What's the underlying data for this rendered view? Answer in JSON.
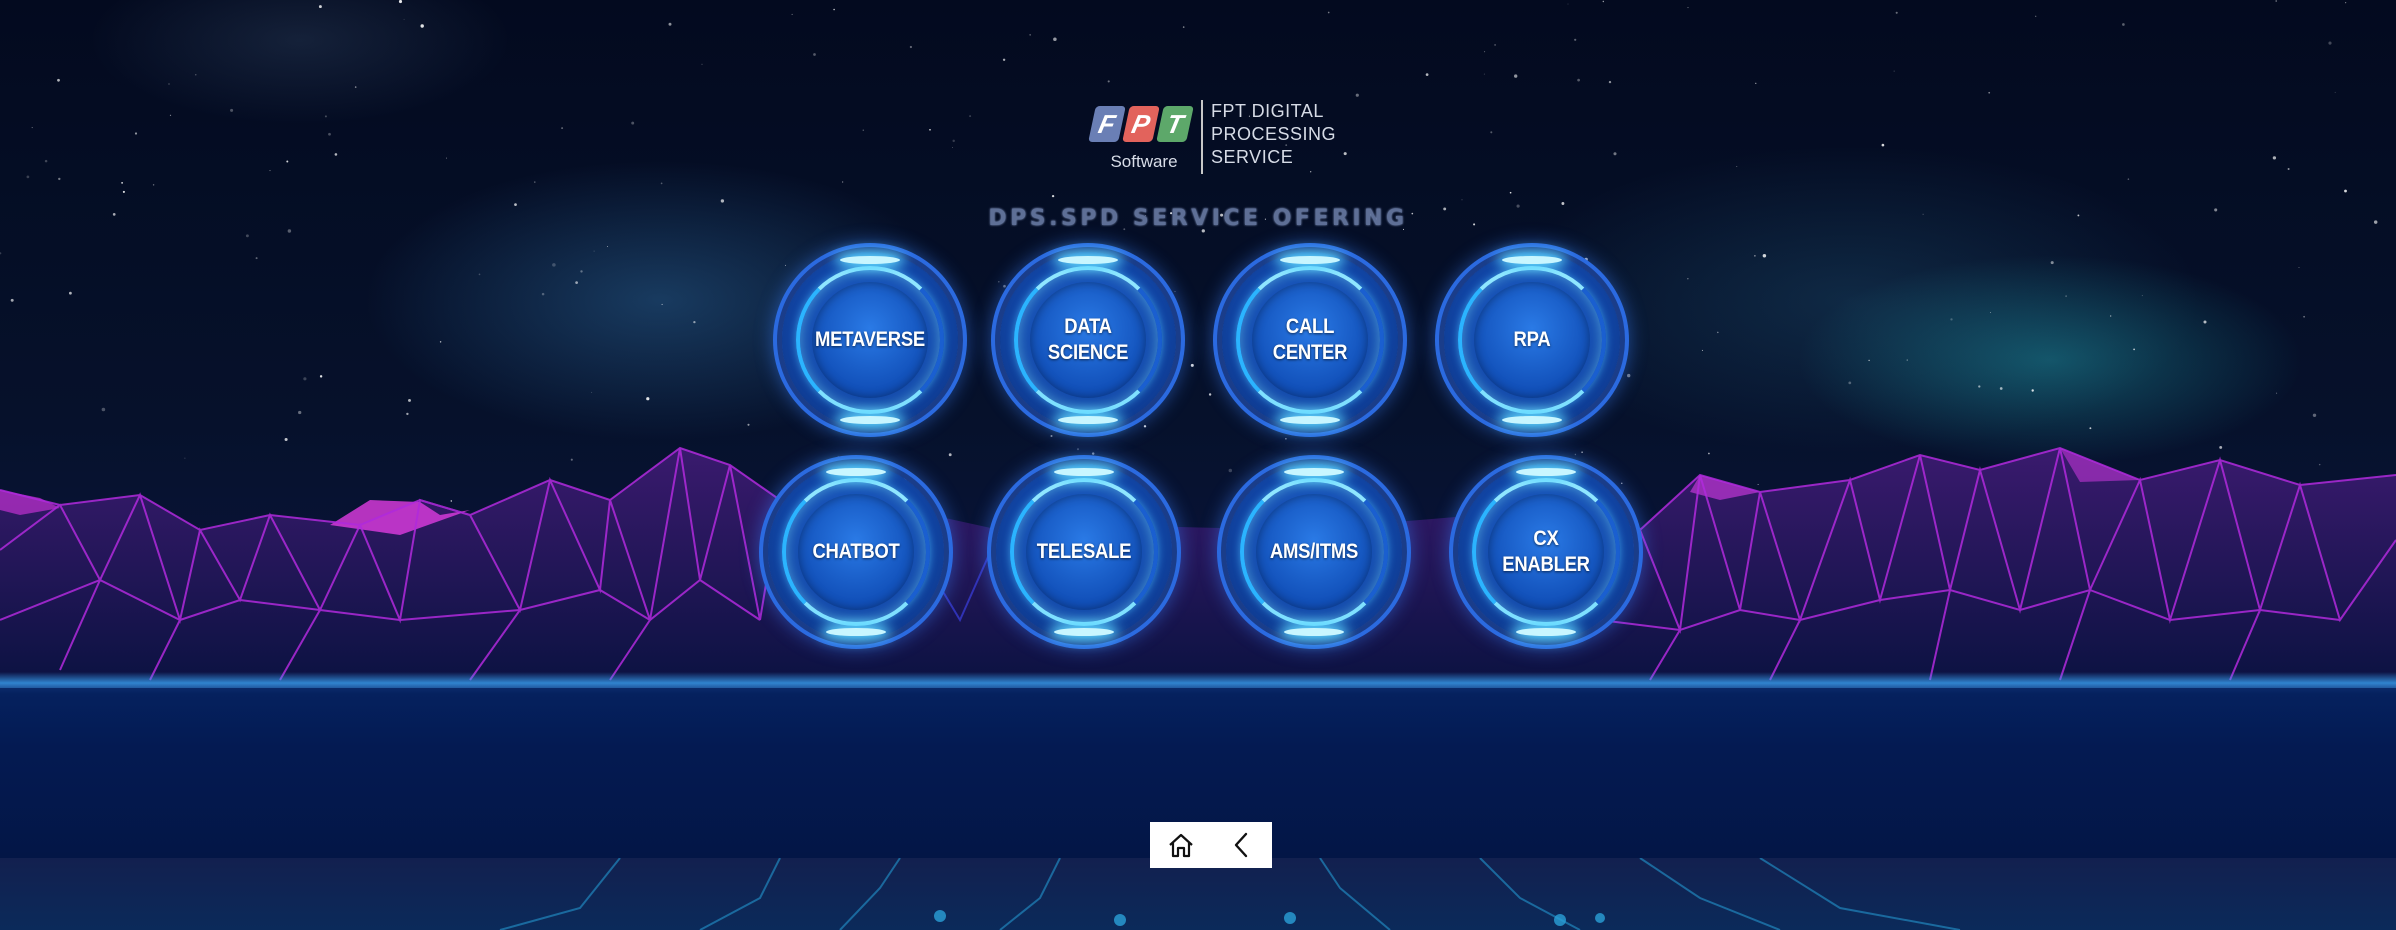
{
  "logo": {
    "brand_letters": [
      "F",
      "P",
      "T"
    ],
    "software_label": "Software",
    "division_text": "FPT DIGITAL\nPROCESSING\nSERVICE"
  },
  "title": "DPS.SPD SERVICE OFERING",
  "services": [
    {
      "label": "METAVERSE"
    },
    {
      "label": "DATA\nSCIENCE"
    },
    {
      "label": "CALL\nCENTER"
    },
    {
      "label": "RPA"
    },
    {
      "label": "CHATBOT"
    },
    {
      "label": "TELESALE"
    },
    {
      "label": "AMS/ITMS"
    },
    {
      "label": "CX\nENABLER"
    }
  ],
  "nav": {
    "home_icon": "home-icon",
    "back_icon": "chevron-left-icon"
  },
  "colors": {
    "accent": "#3ecbff",
    "button_fill": "#1247a8",
    "title": "#5e6f96",
    "mountain_line": "#b02adc"
  }
}
